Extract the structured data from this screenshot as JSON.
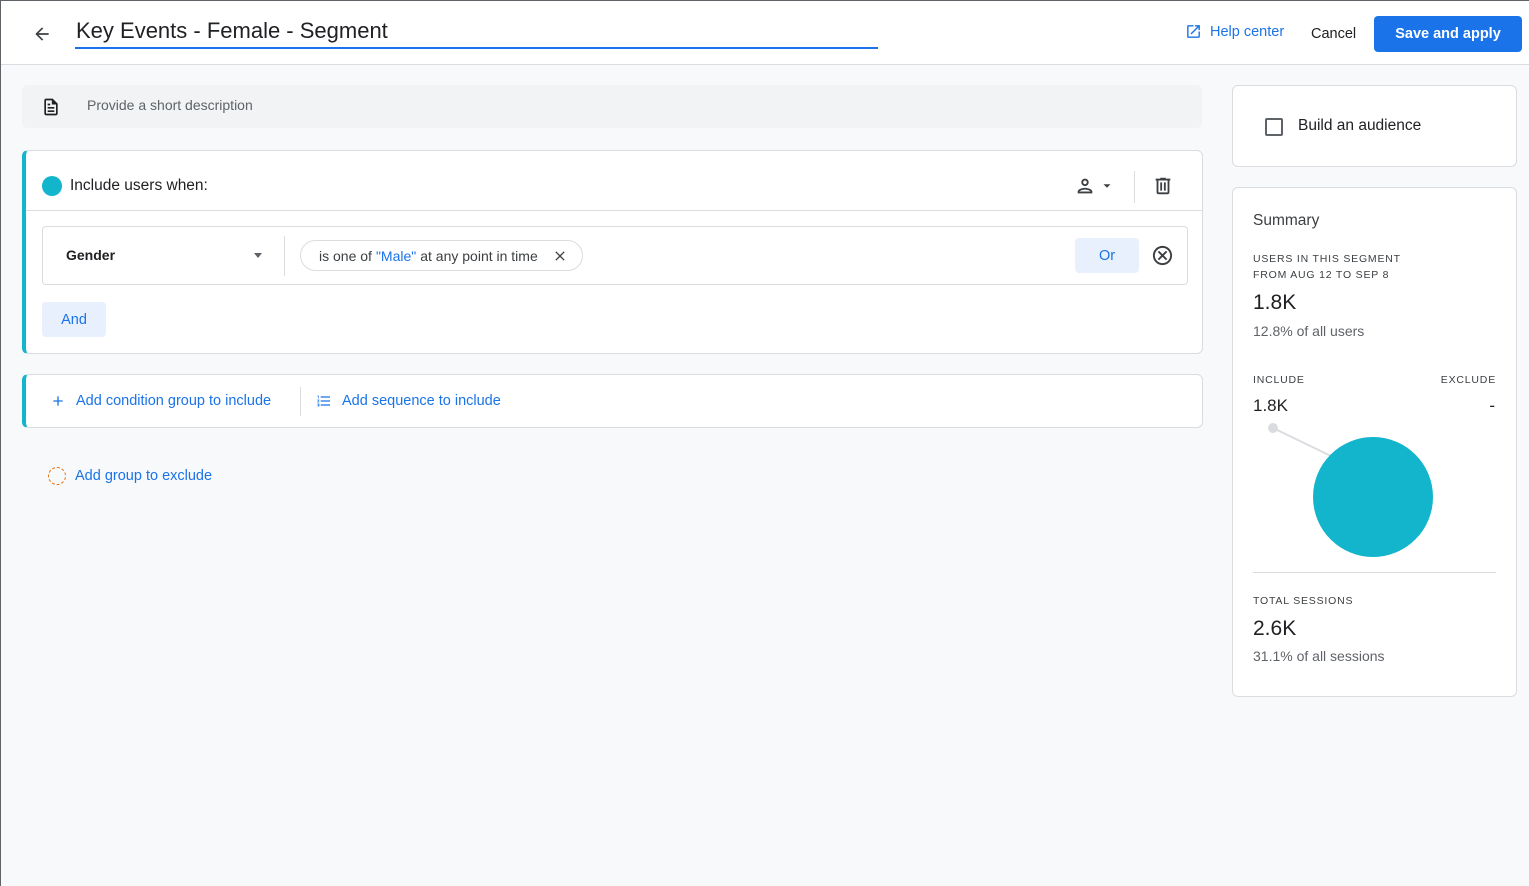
{
  "header": {
    "segment_name": "Key Events - Female - Segment",
    "help_label": "Help center",
    "cancel_label": "Cancel",
    "save_label": "Save and apply"
  },
  "description": {
    "placeholder": "Provide a short description"
  },
  "include_group": {
    "title": "Include users when:",
    "condition": {
      "dimension": "Gender",
      "prefix": "is one of",
      "value": "\"Male\"",
      "suffix": "at any point in time"
    },
    "or_label": "Or",
    "and_label": "And"
  },
  "add_actions": {
    "condition_group_label": "Add condition group to include",
    "sequence_label": "Add sequence to include",
    "exclude_label": "Add group to exclude"
  },
  "audience": {
    "label": "Build an audience",
    "checked": false
  },
  "summary": {
    "title": "Summary",
    "users_heading_line1": "USERS IN THIS SEGMENT",
    "users_heading_line2": "FROM AUG 12 TO SEP 8",
    "users_value": "1.8K",
    "users_pct": "12.8% of all users",
    "include_label": "INCLUDE",
    "exclude_label": "EXCLUDE",
    "include_value": "1.8K",
    "exclude_value": "-",
    "sessions_label": "TOTAL SESSIONS",
    "sessions_value": "2.6K",
    "sessions_pct": "31.1% of all sessions"
  },
  "colors": {
    "accent": "#1a73e8",
    "include_teal": "#12b5cb",
    "exclude_orange": "#e8710a"
  },
  "icons": {
    "back": "arrow-back-icon",
    "help": "open-in-new-icon",
    "description": "document-icon",
    "scope": "person-icon",
    "delete": "trash-icon",
    "chip_remove": "close-icon",
    "row_remove": "cancel-circle-icon",
    "add": "plus-icon",
    "sequence": "list-icon"
  }
}
